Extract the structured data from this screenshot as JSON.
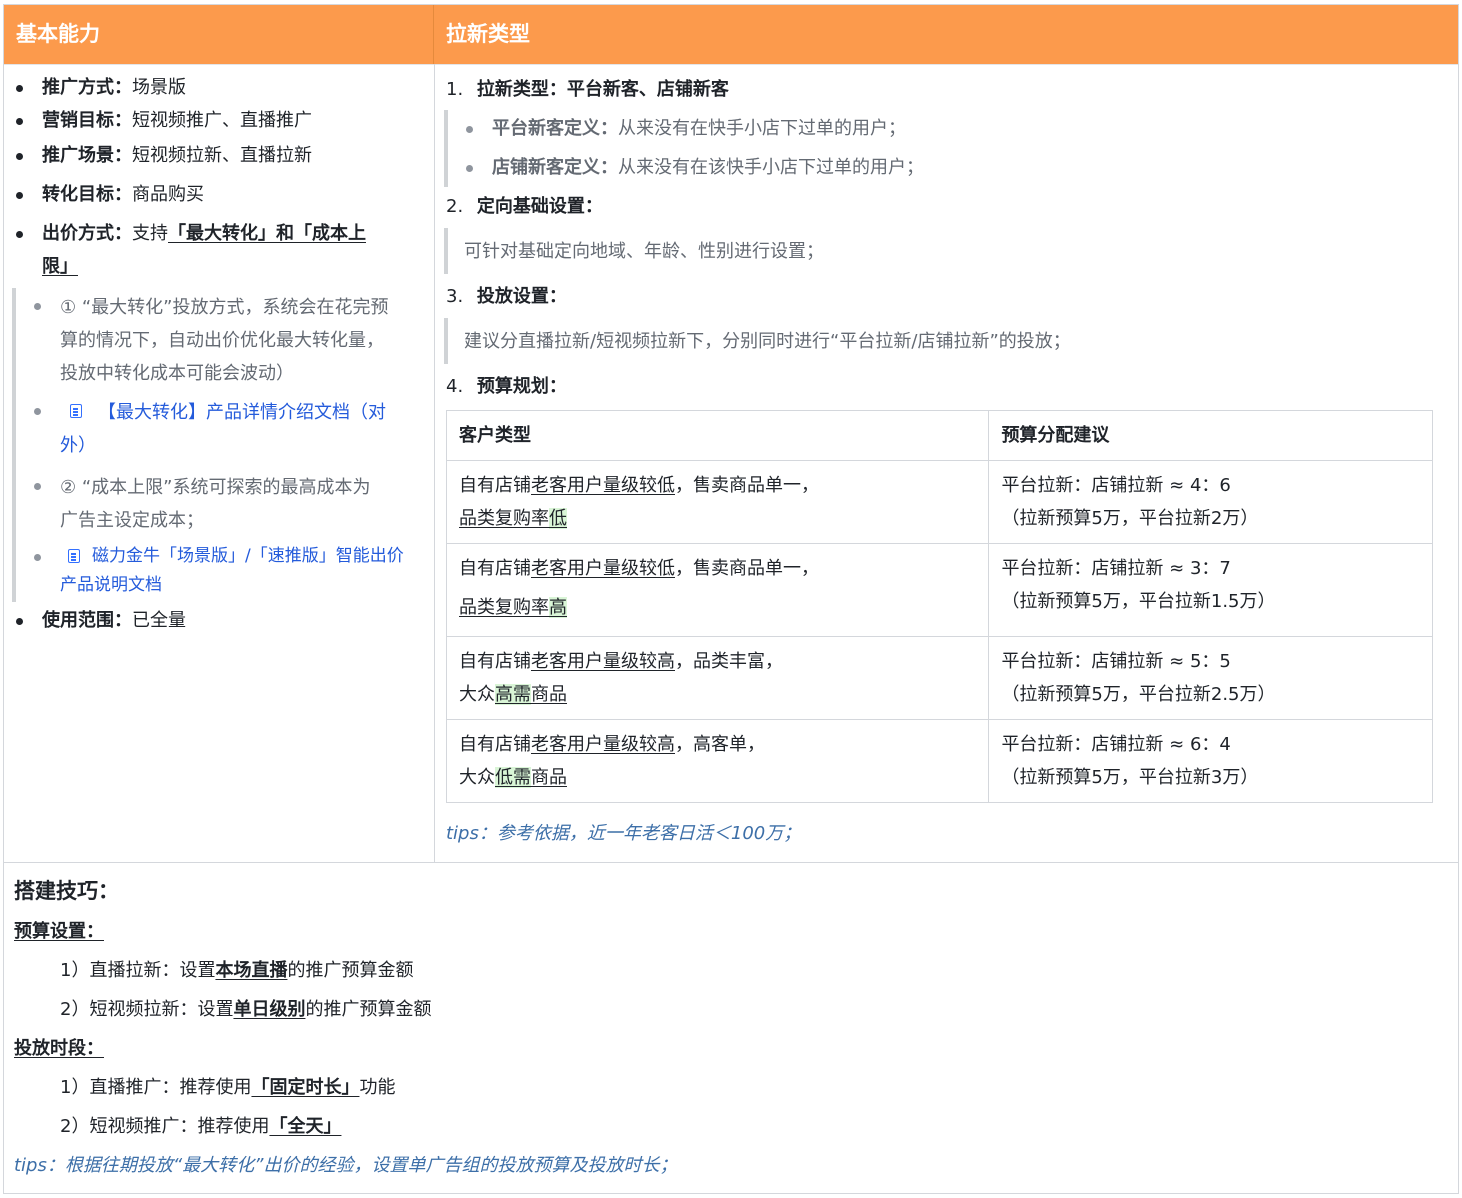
{
  "header": {
    "left": "基本能力",
    "right": "拉新类型"
  },
  "left_list": [
    {
      "label": "推广方式",
      "value": "场景版"
    },
    {
      "label": "营销目标",
      "value": "短视频推广、直播推广"
    },
    {
      "label": "推广场景",
      "value": "短视频拉新、直播拉新"
    },
    {
      "label": "转化目标",
      "value": "商品购买"
    },
    {
      "label": "出价方式",
      "value_prefix": "支持",
      "value_link_1": "「最大转化」和「成本上",
      "value_link_2": "限」"
    },
    {
      "label": "使用范围",
      "value": "已全量"
    }
  ],
  "sub_notes": {
    "n1_l1": "① “最大转化”投放方式，系统会在花完预",
    "n1_l2": "算的情况下，自动出价优化最大转化量，",
    "n1_l3": "投放中转化成本可能会波动）",
    "doc1_l1": "【最大转化】产品详情介绍文档（对",
    "doc1_l2": "外）",
    "n2_l1": "② “成本上限”系统可探索的最高成本为",
    "n2_l2": "广告主设定成本；",
    "doc2_l1": "磁力金牛「场景版」/「速推版」智能出价",
    "doc2_l2": "产品说明文档"
  },
  "sep": "：",
  "right": {
    "s1_num": "1.",
    "s1_title": "拉新类型：平台新客、店铺新客",
    "s1_b1_label": "平台新客定义：",
    "s1_b1_text": "从来没有在快手小店下过单的用户；",
    "s1_b2_label": "店铺新客定义：",
    "s1_b2_text": "从来没有在该快手小店下过单的用户；",
    "s2_num": "2.",
    "s2_title": "定向基础设置：",
    "s2_text": "可针对基础定向地域、年龄、性别进行设置；",
    "s3_num": "3.",
    "s3_title": "投放设置：",
    "s3_text": "建议分直播拉新/短视频拉新下，分别同时进行“平台拉新/店铺拉新”的投放；",
    "s4_num": "4.",
    "s4_title": "预算规划：",
    "tips": "tips：参考依据，近一年老客日活＜100万；"
  },
  "table": {
    "headers": [
      "客户类型",
      "预算分配建议"
    ],
    "rows": [
      {
        "a_pre": "自有店铺",
        "a_ul": "老客用户量级较低",
        "a_post": "，售卖商品单一，",
        "b_pre": "",
        "b_ul": "品类复购率",
        "b_hl": "低",
        "b_post": "",
        "r1": "平台拉新：店铺拉新 ≈  4：6",
        "r2": "（拉新预算5万，平台拉新2万）"
      },
      {
        "a_pre": "自有店铺",
        "a_ul": "老客用户量级较低",
        "a_post": "，售卖商品单一，",
        "b_pre": "",
        "b_ul": "品类复购率",
        "b_hl": "高",
        "b_post": "",
        "r1": "平台拉新：店铺拉新 ≈  3：7",
        "r2": "（拉新预算5万，平台拉新1.5万）"
      },
      {
        "a_pre": "自有店铺",
        "a_ul": "老客用户量级较高",
        "a_post": "，品类丰富，",
        "b_pre": "大众",
        "b_ul": "",
        "b_hl": "高需",
        "b_post": "商品",
        "r1": "平台拉新：店铺拉新 ≈  5：5",
        "r2": "（拉新预算5万，平台拉新2.5万）"
      },
      {
        "a_pre": "自有店铺",
        "a_ul": "老客用户量级较高",
        "a_post": "，高客单，",
        "b_pre": "大众",
        "b_ul": "",
        "b_hl": "低需",
        "b_post": "商品",
        "r1": "平台拉新：店铺拉新 ≈ 6：4",
        "r2": "（拉新预算5万，平台拉新3万）"
      }
    ]
  },
  "bottom": {
    "title": "搭建技巧：",
    "budget_title": "预算设置：",
    "b1_pre": "1）直播拉新：设置",
    "b1_bold": "本场直播",
    "b1_post": "的推广预算金额",
    "b2_pre": "2）短视频拉新：设置",
    "b2_bold": "单日级别",
    "b2_post": "的推广预算金额",
    "time_title": "投放时段：",
    "t1_pre": "1）直播推广：推荐使用",
    "t1_bold": "「固定时长」",
    "t1_post": "功能",
    "t2_pre": "2）短视频推广：推荐使用",
    "t2_bold": "「全天」",
    "tips": "tips：根据往期投放“最大转化”出价的经验，设置单广告组的投放预算及投放时长；"
  }
}
